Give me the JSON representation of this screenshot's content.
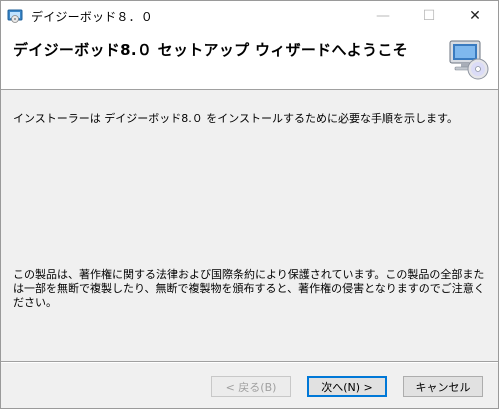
{
  "window": {
    "title": "デイジーボッド８．０",
    "minimize_glyph": "—",
    "maximize_glyph": "☐",
    "close_glyph": "✕"
  },
  "header": {
    "title": "デイジーボッド8.０ セットアップ ウィザードへようこそ",
    "icon": "computer-cd-icon"
  },
  "body": {
    "intro": "インストーラーは デイジーボッド8.０ をインストールするために必要な手順を示します。",
    "legal": "この製品は、著作権に関する法律および国際条約により保護されています。この製品の全部または一部を無断で複製したり、無断で複製物を頒布すると、著作権の侵害となりますのでご注意ください。"
  },
  "buttons": {
    "back": "< 戻る(B)",
    "next": "次へ(N) >",
    "cancel": "キャンセル"
  },
  "colors": {
    "accent": "#0078d7",
    "background": "#f0f0f0",
    "header": "#ffffff"
  }
}
